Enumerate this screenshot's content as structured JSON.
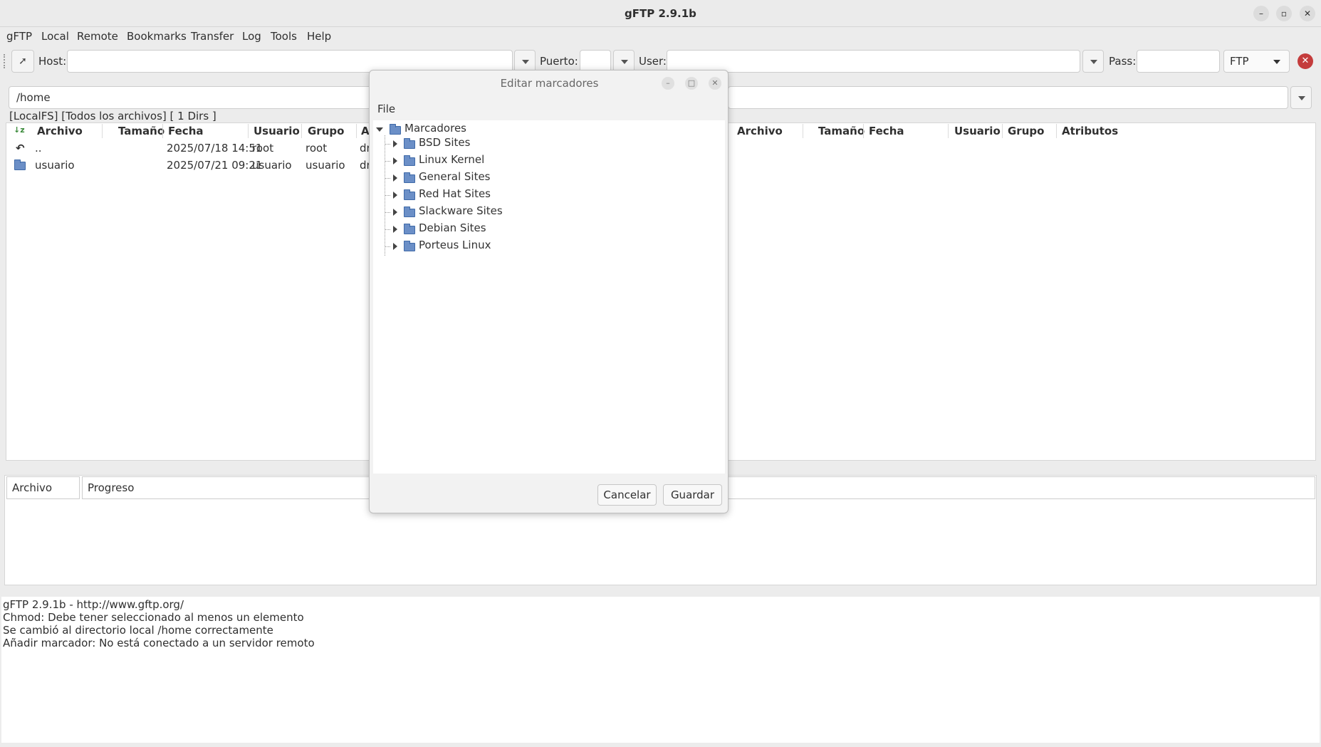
{
  "window": {
    "title": "gFTP 2.9.1b",
    "controls": [
      "minimize-icon",
      "restore-icon",
      "close-icon"
    ]
  },
  "menubar": [
    "gFTP",
    "Local",
    "Remote",
    "Bookmarks",
    "Transfer",
    "Log",
    "Tools",
    "Help"
  ],
  "toolbar": {
    "host_label": "Host:",
    "host_value": "",
    "port_label": "Puerto:",
    "port_value": "",
    "user_label": "User:",
    "user_value": "",
    "pass_label": "Pass:",
    "pass_value": "",
    "protocol": "FTP"
  },
  "local": {
    "path": "/home",
    "status": "[LocalFS] [Todos los archivos] [ 1 Dirs ]",
    "columns": [
      "Archivo",
      "Tamaño",
      "Fecha",
      "Usuario",
      "Grupo",
      "A"
    ],
    "rows": [
      {
        "name": "..",
        "size": "",
        "date": "2025/07/18 14:51",
        "user": "root",
        "group": "root",
        "attr": "dr"
      },
      {
        "name": "usuario",
        "size": "",
        "date": "2025/07/21 09:21",
        "user": "usuario",
        "group": "usuario",
        "attr": "dr"
      }
    ]
  },
  "remote": {
    "path": "",
    "columns": [
      "Archivo",
      "Tamaño",
      "Fecha",
      "Usuario",
      "Grupo",
      "Atributos"
    ]
  },
  "queue": {
    "columns": [
      "Archivo",
      "Progreso"
    ]
  },
  "log": [
    "gFTP 2.9.1b - http://www.gftp.org/",
    "Chmod: Debe tener seleccionado al menos un elemento",
    "Se cambió al directorio local /home correctamente",
    "Añadir marcador: No está conectado a un servidor remoto"
  ],
  "dialog": {
    "title": "Editar marcadores",
    "menu": "File",
    "root": "Marcadores",
    "items": [
      "BSD Sites",
      "Linux Kernel",
      "General Sites",
      "Red Hat Sites",
      "Slackware Sites",
      "Debian Sites",
      "Porteus Linux"
    ],
    "cancel_label": "Cancelar",
    "save_label": "Guardar"
  }
}
